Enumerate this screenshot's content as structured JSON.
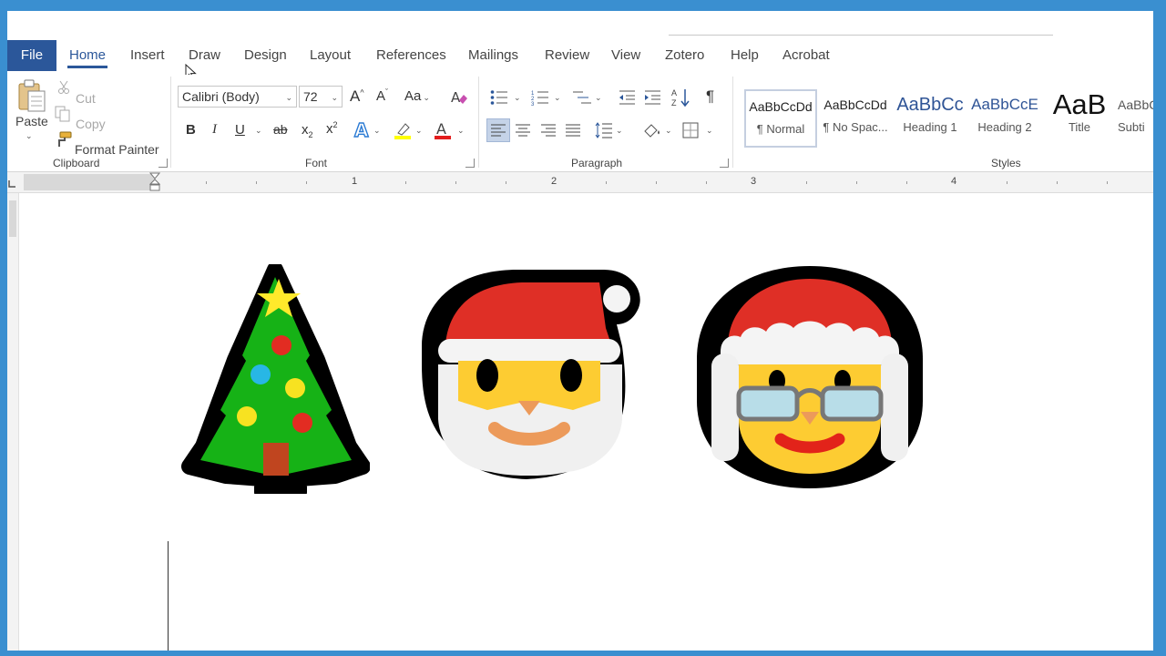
{
  "tabs": {
    "file": "File",
    "home": "Home",
    "insert": "Insert",
    "draw": "Draw",
    "design": "Design",
    "layout": "Layout",
    "references": "References",
    "mailings": "Mailings",
    "review": "Review",
    "view": "View",
    "zotero": "Zotero",
    "help": "Help",
    "acrobat": "Acrobat"
  },
  "clipboard": {
    "paste": "Paste",
    "cut": "Cut",
    "copy": "Copy",
    "format_painter": "Format Painter",
    "label": "Clipboard"
  },
  "font": {
    "name": "Calibri (Body)",
    "size": "72",
    "change_case": "Aa",
    "bold": "B",
    "italic": "I",
    "underline": "U",
    "strike": "ab",
    "subscript": "x",
    "superscript": "x",
    "label": "Font"
  },
  "paragraph": {
    "label": "Paragraph",
    "pilcrow": "¶"
  },
  "styles": {
    "label": "Styles",
    "items": [
      {
        "sample": "AaBbCcDd",
        "name": "¶ Normal"
      },
      {
        "sample": "AaBbCcDd",
        "name": "¶ No Spac..."
      },
      {
        "sample": "AaBbCc",
        "name": "Heading 1"
      },
      {
        "sample": "AaBbCcE",
        "name": "Heading 2"
      },
      {
        "sample": "AaB",
        "name": "Title"
      },
      {
        "sample": "AaBbC",
        "name": "Subti"
      }
    ]
  },
  "ruler": {
    "numbers": [
      "1",
      "2",
      "3",
      "4"
    ]
  },
  "document": {
    "emoji": [
      "christmas-tree",
      "santa-claus",
      "mrs-claus"
    ]
  },
  "colors": {
    "brand": "#2b579a",
    "frame": "#3a8fd0",
    "highlight": "#ffff00",
    "font_color": "#e31c1c"
  }
}
